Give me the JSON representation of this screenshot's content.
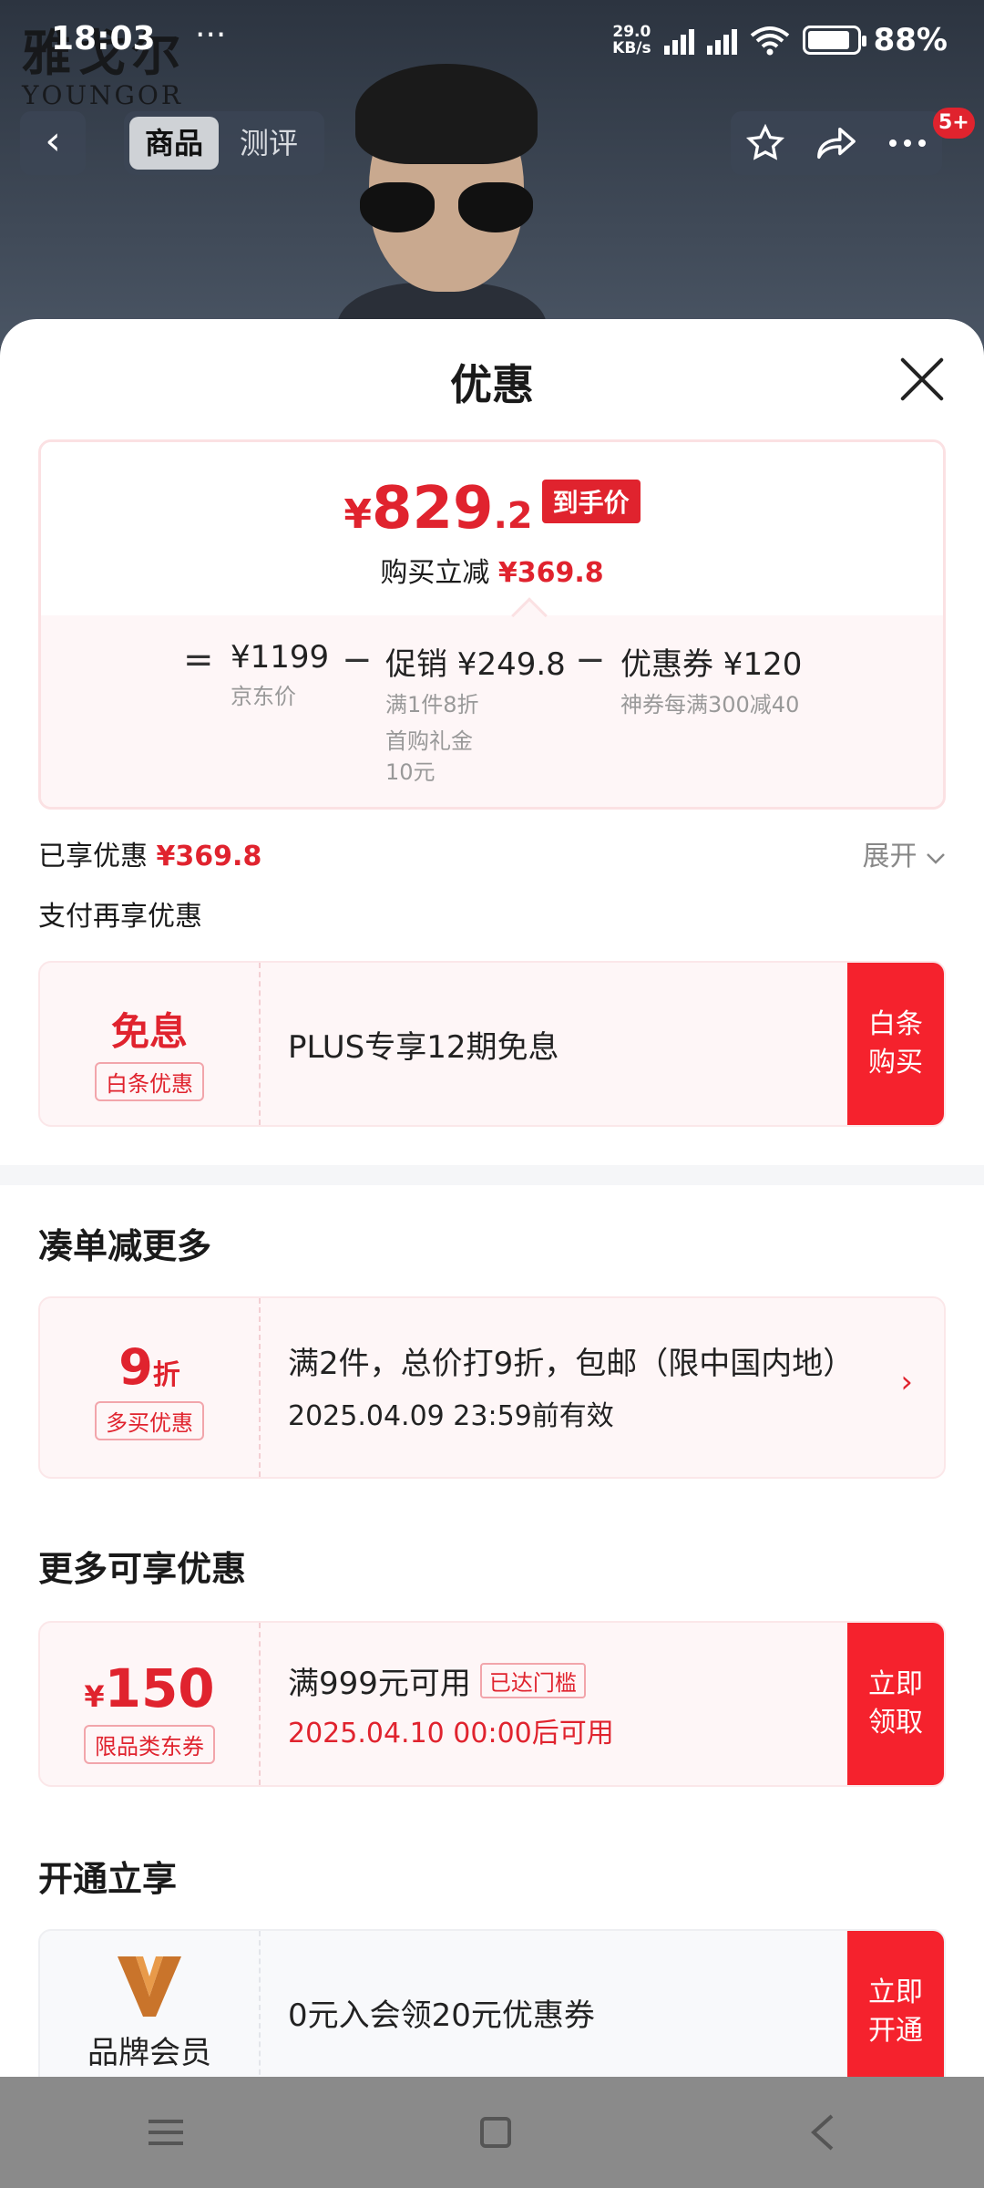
{
  "status_bar": {
    "time": "18:03",
    "more": "···",
    "net_speed_value": "29.0",
    "net_speed_unit": "KB/s",
    "battery_pct": "88%",
    "battery_level": 0.88
  },
  "watermark": {
    "cn": "雅戈尔",
    "en": "YOUNGOR"
  },
  "nav": {
    "back": "‹",
    "tabs": [
      {
        "label": "商品",
        "active": true
      },
      {
        "label": "测评",
        "active": false
      }
    ],
    "badge": "5+"
  },
  "sheet": {
    "title": "优惠",
    "price_card": {
      "currency": "¥",
      "final_int": "829",
      "final_dec": ".2",
      "final_tag": "到手价",
      "instant_label": "购买立减",
      "instant_amount": "¥369.8",
      "eq": "=",
      "minus": "−",
      "jd_price": "¥1199",
      "jd_price_label": "京东价",
      "promo": "促销 ¥249.8",
      "promo_sub1": "满1件8折",
      "promo_sub2": "首购礼金",
      "promo_sub3": "10元",
      "coupon": "优惠券 ¥120",
      "coupon_sub": "神券每满300减40"
    },
    "enjoyed_label": "已享优惠",
    "enjoyed_amount": "¥369.8",
    "expand_label": "展开",
    "pay_more_label": "支付再享优惠",
    "baitiao": {
      "big": "免息",
      "tag": "白条优惠",
      "text": "PLUS专享12期免息",
      "action": "白条购买"
    },
    "bundle_title": "凑单减更多",
    "bundle": {
      "big_num": "9",
      "big_unit": "折",
      "tag": "多买优惠",
      "line1": "满2件，总价打9折，包邮（限中国内地）",
      "line2": "2025.04.09 23:59前有效"
    },
    "more_title": "更多可享优惠",
    "coupon_card": {
      "currency": "¥",
      "amount": "150",
      "tag": "限品类东券",
      "line1": "满999元可用",
      "reached": "已达门槛",
      "line2": "2025.04.10 00:00后可用",
      "action": "立即领取"
    },
    "open_title": "开通立享",
    "member_card": {
      "label": "品牌会员",
      "text": "0元入会领20元优惠券",
      "action": "立即开通"
    }
  },
  "colors": {
    "accent": "#e0232e",
    "cta": "#f5222d"
  }
}
